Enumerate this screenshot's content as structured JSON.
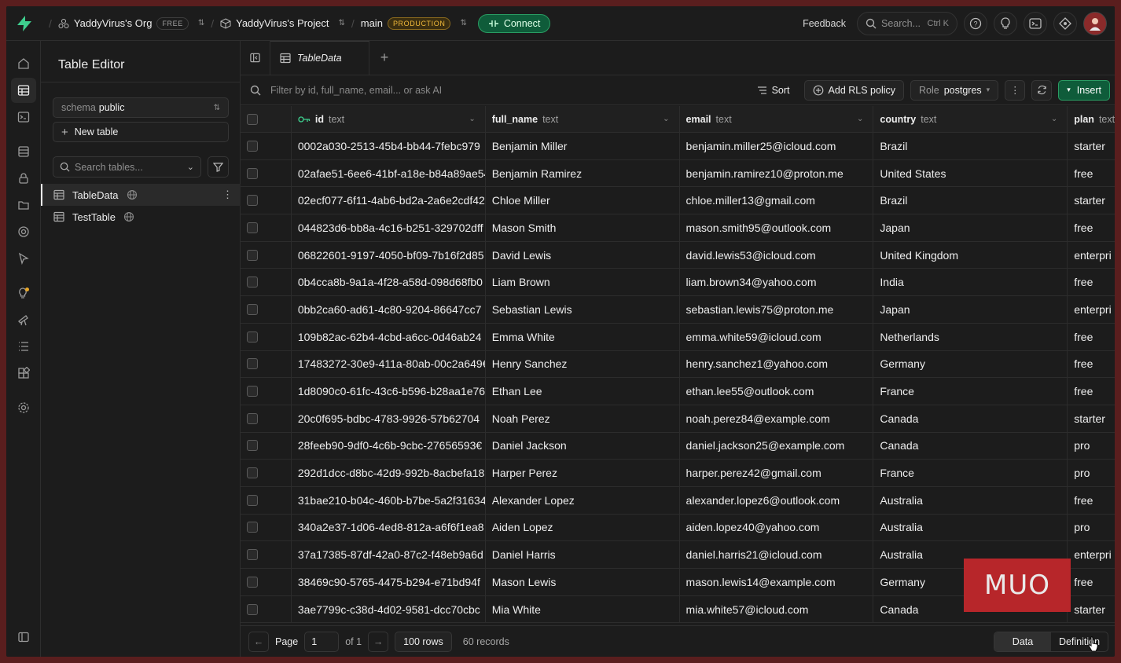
{
  "topbar": {
    "org_name": "YaddyVirus's Org",
    "org_badge": "FREE",
    "project_name": "YaddyVirus's Project",
    "branch_name": "main",
    "branch_badge": "PRODUCTION",
    "connect_label": "Connect",
    "feedback_label": "Feedback",
    "search_placeholder": "Search...",
    "search_shortcut": "Ctrl K"
  },
  "sidebar": {
    "title": "Table Editor",
    "schema_key": "schema",
    "schema_value": "public",
    "new_table_label": "New table",
    "search_placeholder": "Search tables...",
    "tables": [
      {
        "name": "TableData"
      },
      {
        "name": "TestTable"
      }
    ]
  },
  "tab": {
    "label": "TableData"
  },
  "toolbar": {
    "filter_placeholder": "Filter by id, full_name, email... or ask AI",
    "sort_label": "Sort",
    "rls_label": "Add RLS policy",
    "role_key": "Role",
    "role_value": "postgres",
    "insert_label": "Insert"
  },
  "grid": {
    "columns": [
      {
        "name": "id",
        "type": "text"
      },
      {
        "name": "full_name",
        "type": "text"
      },
      {
        "name": "email",
        "type": "text"
      },
      {
        "name": "country",
        "type": "text"
      },
      {
        "name": "plan",
        "type": "text"
      }
    ],
    "rows": [
      [
        "0002a030-2513-45b4-bb44-7febc979",
        "Benjamin Miller",
        "benjamin.miller25@icloud.com",
        "Brazil",
        "starter"
      ],
      [
        "02afae51-6ee6-41bf-a18e-b84a89ae54",
        "Benjamin Ramirez",
        "benjamin.ramirez10@proton.me",
        "United States",
        "free"
      ],
      [
        "02ecf077-6f11-4ab6-bd2a-2a6e2cdf42",
        "Chloe Miller",
        "chloe.miller13@gmail.com",
        "Brazil",
        "starter"
      ],
      [
        "044823d6-bb8a-4c16-b251-329702dff",
        "Mason Smith",
        "mason.smith95@outlook.com",
        "Japan",
        "free"
      ],
      [
        "06822601-9197-4050-bf09-7b16f2d85",
        "David Lewis",
        "david.lewis53@icloud.com",
        "United Kingdom",
        "enterpri"
      ],
      [
        "0b4cca8b-9a1a-4f28-a58d-098d68fb0",
        "Liam Brown",
        "liam.brown34@yahoo.com",
        "India",
        "free"
      ],
      [
        "0bb2ca60-ad61-4c80-9204-86647cc7",
        "Sebastian Lewis",
        "sebastian.lewis75@proton.me",
        "Japan",
        "enterpri"
      ],
      [
        "109b82ac-62b4-4cbd-a6cc-0d46ab24",
        "Emma White",
        "emma.white59@icloud.com",
        "Netherlands",
        "free"
      ],
      [
        "17483272-30e9-411a-80ab-00c2a649€",
        "Henry Sanchez",
        "henry.sanchez1@yahoo.com",
        "Germany",
        "free"
      ],
      [
        "1d8090c0-61fc-43c6-b596-b28aa1e76",
        "Ethan Lee",
        "ethan.lee55@outlook.com",
        "France",
        "free"
      ],
      [
        "20c0f695-bdbc-4783-9926-57b62704",
        "Noah Perez",
        "noah.perez84@example.com",
        "Canada",
        "starter"
      ],
      [
        "28feeb90-9df0-4c6b-9cbc-27656593€",
        "Daniel Jackson",
        "daniel.jackson25@example.com",
        "Canada",
        "pro"
      ],
      [
        "292d1dcc-d8bc-42d9-992b-8acbefa18",
        "Harper Perez",
        "harper.perez42@gmail.com",
        "France",
        "pro"
      ],
      [
        "31bae210-b04c-460b-b7be-5a2f31634",
        "Alexander Lopez",
        "alexander.lopez6@outlook.com",
        "Australia",
        "free"
      ],
      [
        "340a2e37-1d06-4ed8-812a-a6f6f1ea8",
        "Aiden Lopez",
        "aiden.lopez40@yahoo.com",
        "Australia",
        "pro"
      ],
      [
        "37a17385-87df-42a0-87c2-f48eb9a6d",
        "Daniel Harris",
        "daniel.harris21@icloud.com",
        "Australia",
        "enterpri"
      ],
      [
        "38469c90-5765-4475-b294-e71bd94f",
        "Mason Lewis",
        "mason.lewis14@example.com",
        "Germany",
        "free"
      ],
      [
        "3ae7799c-c38d-4d02-9581-dcc70cbc",
        "Mia White",
        "mia.white57@icloud.com",
        "Canada",
        "starter"
      ]
    ]
  },
  "footer": {
    "page_label": "Page",
    "page_value": "1",
    "of_label": "of 1",
    "rows_label": "100 rows",
    "records_label": "60 records",
    "view_data": "Data",
    "view_definition": "Definition"
  },
  "watermark": "MUO",
  "colors": {
    "accent_green": "#2a9d63",
    "production_badge": "#f1b93a",
    "watermark_red": "#b7262a"
  }
}
